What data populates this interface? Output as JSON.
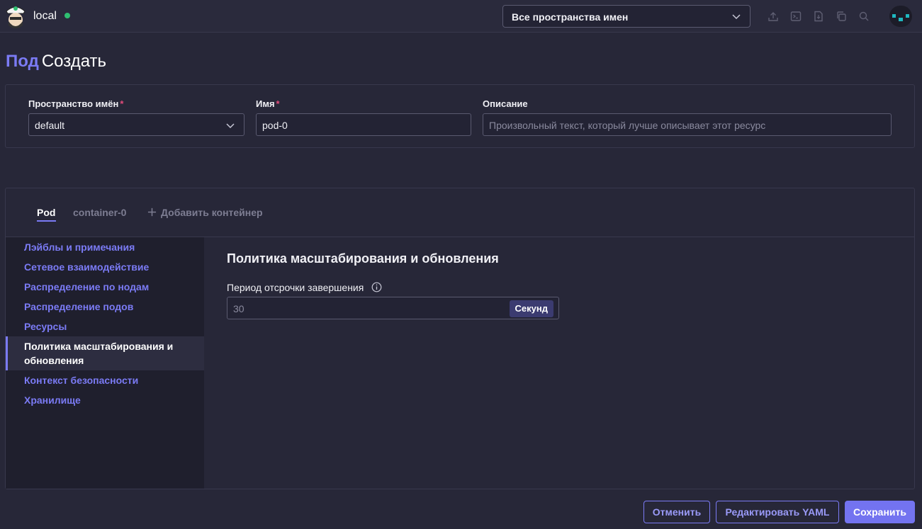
{
  "header": {
    "cluster_name": "local",
    "namespace_select": "Все пространства имен",
    "icons": [
      "upload-icon",
      "terminal-icon",
      "file-icon",
      "copy-icon",
      "search-icon"
    ],
    "status_color": "#2fbf71"
  },
  "title": {
    "type": "Под",
    "action": "Создать"
  },
  "form": {
    "namespace_label": "Пространство имён",
    "namespace_value": "default",
    "name_label": "Имя",
    "name_value": "pod-0",
    "description_label": "Описание",
    "description_placeholder": "Произвольный текст, который лучше описывает этот ресурс",
    "required_mark": "*"
  },
  "tabs": [
    {
      "label": "Pod",
      "active": true
    },
    {
      "label": "container-0",
      "active": false
    },
    {
      "label": "Добавить контейнер",
      "active": false
    }
  ],
  "sidebar": {
    "items": [
      {
        "label": "Лэйблы и примечания"
      },
      {
        "label": "Сетевое взаимодействие"
      },
      {
        "label": "Распределение по нодам"
      },
      {
        "label": "Распределение подов"
      },
      {
        "label": "Ресурсы"
      },
      {
        "label": "Политика масштабирования и обновления",
        "active": true
      },
      {
        "label": "Контекст безопасности"
      },
      {
        "label": "Хранилище"
      }
    ]
  },
  "content": {
    "section_title": "Политика масштабирования и обновления",
    "period_label": "Период отсрочки завершения",
    "period_placeholder": "30",
    "unit": "Секунд"
  },
  "footer": {
    "cancel": "Отменить",
    "edit_yaml": "Редактировать YAML",
    "save": "Сохранить"
  },
  "colors": {
    "accent": "#7b7bf5",
    "background": "#272738",
    "required": "#e24b7b"
  }
}
